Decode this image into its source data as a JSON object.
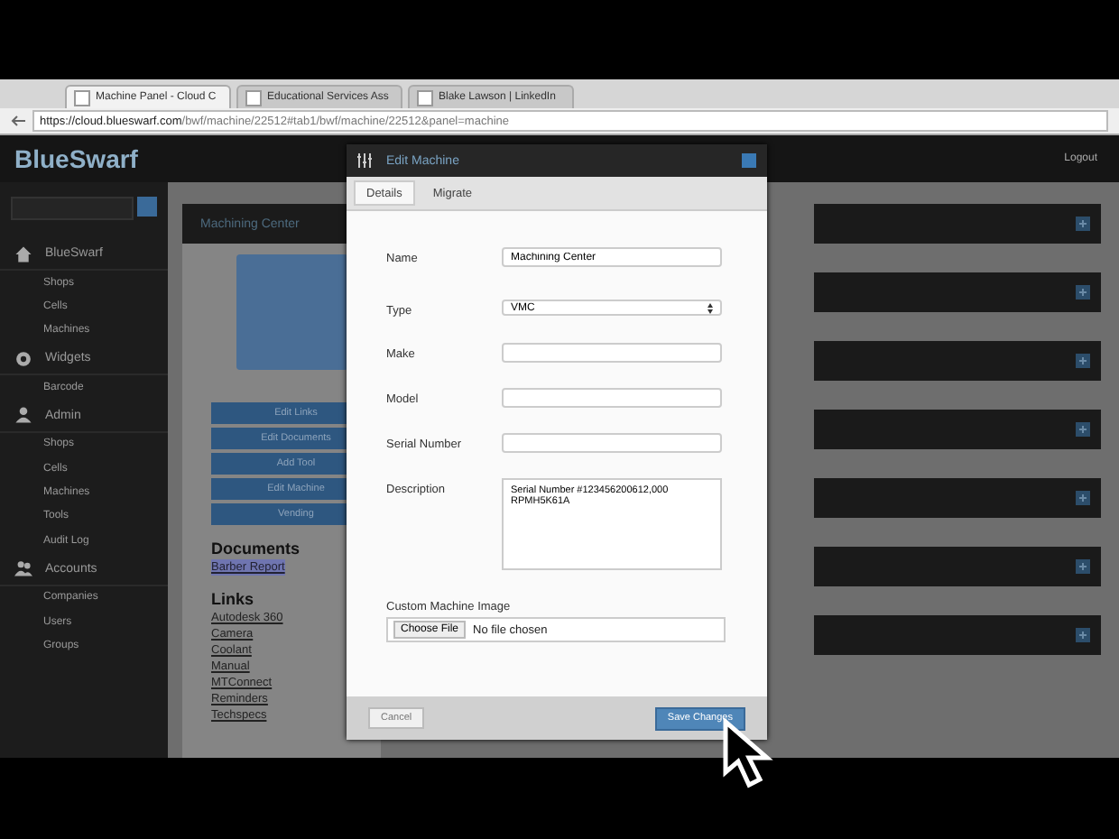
{
  "browser": {
    "tabs": [
      {
        "label": "Machine Panel - Cloud C",
        "selected": true
      },
      {
        "label": "Educational Services Ass",
        "selected": false
      },
      {
        "label": "Blake Lawson | LinkedIn",
        "selected": false
      }
    ],
    "url_host": "https://cloud.blueswarf.com",
    "url_path": "/bwf/machine/22512#tab1/bwf/machine/22512&panel=machine"
  },
  "header": {
    "logo": "BlueSwarf",
    "logout": "Logout"
  },
  "sidebar": {
    "sections": [
      {
        "label": "BlueSwarf",
        "items": [
          "Shops",
          "Cells",
          "Machines"
        ]
      },
      {
        "label": "Widgets",
        "items": [
          "Barcode"
        ]
      },
      {
        "label": "Admin",
        "items": [
          "Shops",
          "Cells",
          "Machines",
          "Tools",
          "Audit Log"
        ]
      },
      {
        "label": "Accounts",
        "items": [
          "Companies",
          "Users",
          "Groups"
        ]
      }
    ]
  },
  "machine_panel": {
    "title": "Machining Center",
    "buttons": [
      "Edit Links",
      "Edit Documents",
      "Add Tool",
      "Edit Machine",
      "Vending"
    ],
    "documents_heading": "Documents",
    "documents": [
      "Barber Report"
    ],
    "links_heading": "Links",
    "links": [
      "Autodesk 360",
      "Camera",
      "Coolant",
      "Manual",
      "MTConnect",
      "Reminders",
      "Techspecs"
    ]
  },
  "panels": [
    {
      "expanded": false
    },
    {
      "expanded": false
    },
    {
      "expanded": false
    },
    {
      "expanded": false
    },
    {
      "expanded": false
    },
    {
      "expanded": false
    },
    {
      "expanded": false
    }
  ],
  "dialog": {
    "title": "Edit Machine",
    "tabs": [
      {
        "label": "Details",
        "selected": true
      },
      {
        "label": "Migrate",
        "selected": false
      }
    ],
    "fields": [
      {
        "kind": "text",
        "label": "Name",
        "value": "Machining Center"
      },
      {
        "kind": "select",
        "label": "Type",
        "value": "VMC"
      },
      {
        "kind": "text",
        "label": "Make"
      },
      {
        "kind": "text",
        "label": "Model"
      },
      {
        "kind": "text",
        "label": "Serial Number"
      },
      {
        "kind": "textarea",
        "label": "Description",
        "value": "Serial Number #123456200612,000 RPMH5K61A"
      },
      {
        "kind": "file",
        "label": "Custom Machine Image",
        "button": "Choose File",
        "status": "No file chosen"
      }
    ],
    "cancel": "Cancel",
    "save": "Save Changes"
  }
}
